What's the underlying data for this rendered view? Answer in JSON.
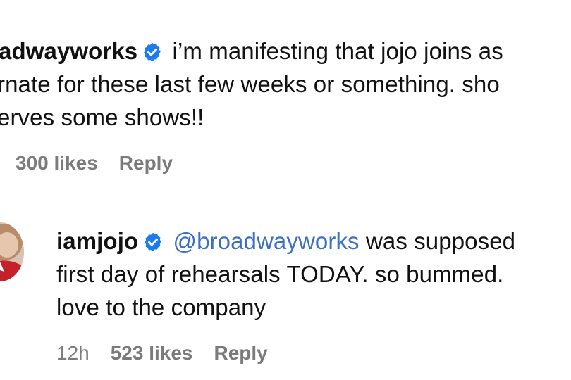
{
  "comment1": {
    "username": "adwayworks",
    "text_line1": "i’m manifesting that jojo joins as",
    "text_line2": "rnate for these last few weeks or something. sho",
    "text_line3": "erves some shows!!",
    "likes": "300 likes",
    "reply_label": "Reply"
  },
  "comment2": {
    "username": "iamjojo",
    "mention": "@broadwayworks",
    "text_line1_rest": " was supposed",
    "text_line2": "first day of rehearsals TODAY. so bummed.",
    "text_line3": "love to the company",
    "time": "12h",
    "likes": "523 likes",
    "reply_label": "Reply"
  },
  "icons": {
    "verified": "verified-badge-icon",
    "avatar": "avatar"
  },
  "colors": {
    "verified_badge": "#1d7bf0",
    "mention": "#3a6fc4",
    "meta_text": "#7b7b7b"
  }
}
